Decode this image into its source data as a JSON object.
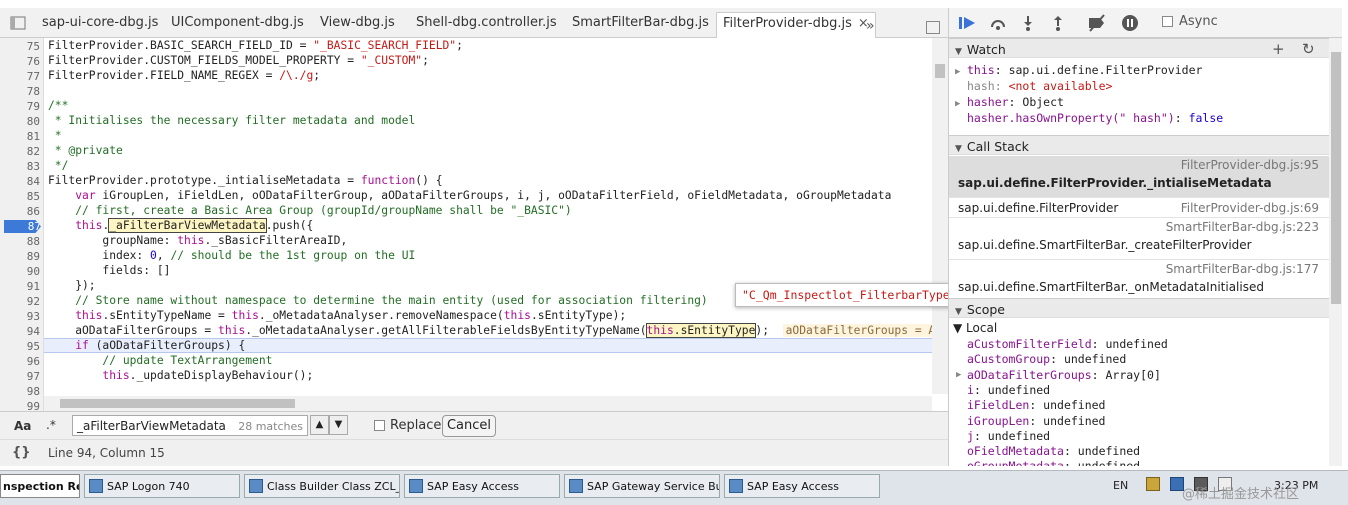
{
  "tabs": [
    {
      "label": "sap-ui-core-dbg.js",
      "active": false
    },
    {
      "label": "UIComponent-dbg.js",
      "active": false
    },
    {
      "label": "View-dbg.js",
      "active": false
    },
    {
      "label": "Shell-dbg.controller.js",
      "active": false
    },
    {
      "label": "SmartFilterBar-dbg.js",
      "active": false
    },
    {
      "label": "FilterProvider-dbg.js",
      "active": true
    }
  ],
  "tab_close": "×",
  "tab_overflow": "»",
  "editor": {
    "line_numbers": [
      "75",
      "76",
      "77",
      "78",
      "79",
      "80",
      "81",
      "82",
      "83",
      "84",
      "85",
      "86",
      "87",
      "88",
      "89",
      "90",
      "91",
      "92",
      "93",
      "94",
      "95",
      "96",
      "97",
      "98",
      "99"
    ],
    "breakpoint_line": "87",
    "current_line": "95"
  },
  "tooltip": "\"C_Qm_Inspectlot_FilterbarType\"",
  "search": {
    "aa": "Aa",
    "regex": ".*",
    "query": "_aFilterBarViewMetadata",
    "matches": "28 matches",
    "up": "▲",
    "down": "▼",
    "replace_label": "Replace",
    "cancel_label": "Cancel"
  },
  "status": {
    "braces": "{}",
    "position": "Line 94, Column 15"
  },
  "debugger": {
    "async_label": "Async"
  },
  "watch": {
    "title": "Watch",
    "add": "+",
    "refresh": "↻",
    "items": [
      {
        "arrow": "▶",
        "name": "this",
        "value": "sap.ui.define.FilterProvider"
      },
      {
        "arrow": "",
        "name": "hash",
        "value": "<not available>"
      },
      {
        "arrow": "▶",
        "name": "hasher",
        "value": "Object"
      },
      {
        "arrow": "",
        "name": "hasher.hasOwnProperty(\" hash\")",
        "value": "false"
      }
    ]
  },
  "callstack": {
    "title": "Call Stack",
    "frames": [
      {
        "fn": "sap.ui.define.FilterProvider._intialiseMetadata",
        "loc": "FilterProvider-dbg.js:95",
        "selected": true
      },
      {
        "fn": "sap.ui.define.FilterProvider",
        "loc": "FilterProvider-dbg.js:69",
        "selected": false
      },
      {
        "fn": "sap.ui.define.SmartFilterBar._createFilterProvider",
        "loc": "SmartFilterBar-dbg.js:223",
        "selected": false
      },
      {
        "fn": "sap.ui.define.SmartFilterBar._onMetadataInitialised",
        "loc": "SmartFilterBar-dbg.js:177",
        "selected": false
      }
    ]
  },
  "scope": {
    "title": "Scope",
    "local_title": "Local",
    "vars": [
      {
        "name": "aCustomFilterField",
        "value": "undefined",
        "expandable": false
      },
      {
        "name": "aCustomGroup",
        "value": "undefined",
        "expandable": false
      },
      {
        "name": "aODataFilterGroups",
        "value": "Array[0]",
        "expandable": true
      },
      {
        "name": "i",
        "value": "undefined",
        "expandable": false
      },
      {
        "name": "iFieldLen",
        "value": "undefined",
        "expandable": false
      },
      {
        "name": "iGroupLen",
        "value": "undefined",
        "expandable": false
      },
      {
        "name": "j",
        "value": "undefined",
        "expandable": false
      },
      {
        "name": "oFieldMetadata",
        "value": "undefined",
        "expandable": false
      },
      {
        "name": "oGroupMetadata",
        "value": "undefined",
        "expandable": false
      }
    ]
  },
  "taskbar": {
    "items": [
      "nspection Re...",
      "SAP Logon 740",
      "Class Builder Class ZCL_...",
      "SAP Easy Access",
      "SAP Gateway Service Bui...",
      "SAP Easy Access"
    ],
    "lang": "EN",
    "clock": "3:23 PM",
    "watermark": "@稀土掘金技术社区"
  }
}
